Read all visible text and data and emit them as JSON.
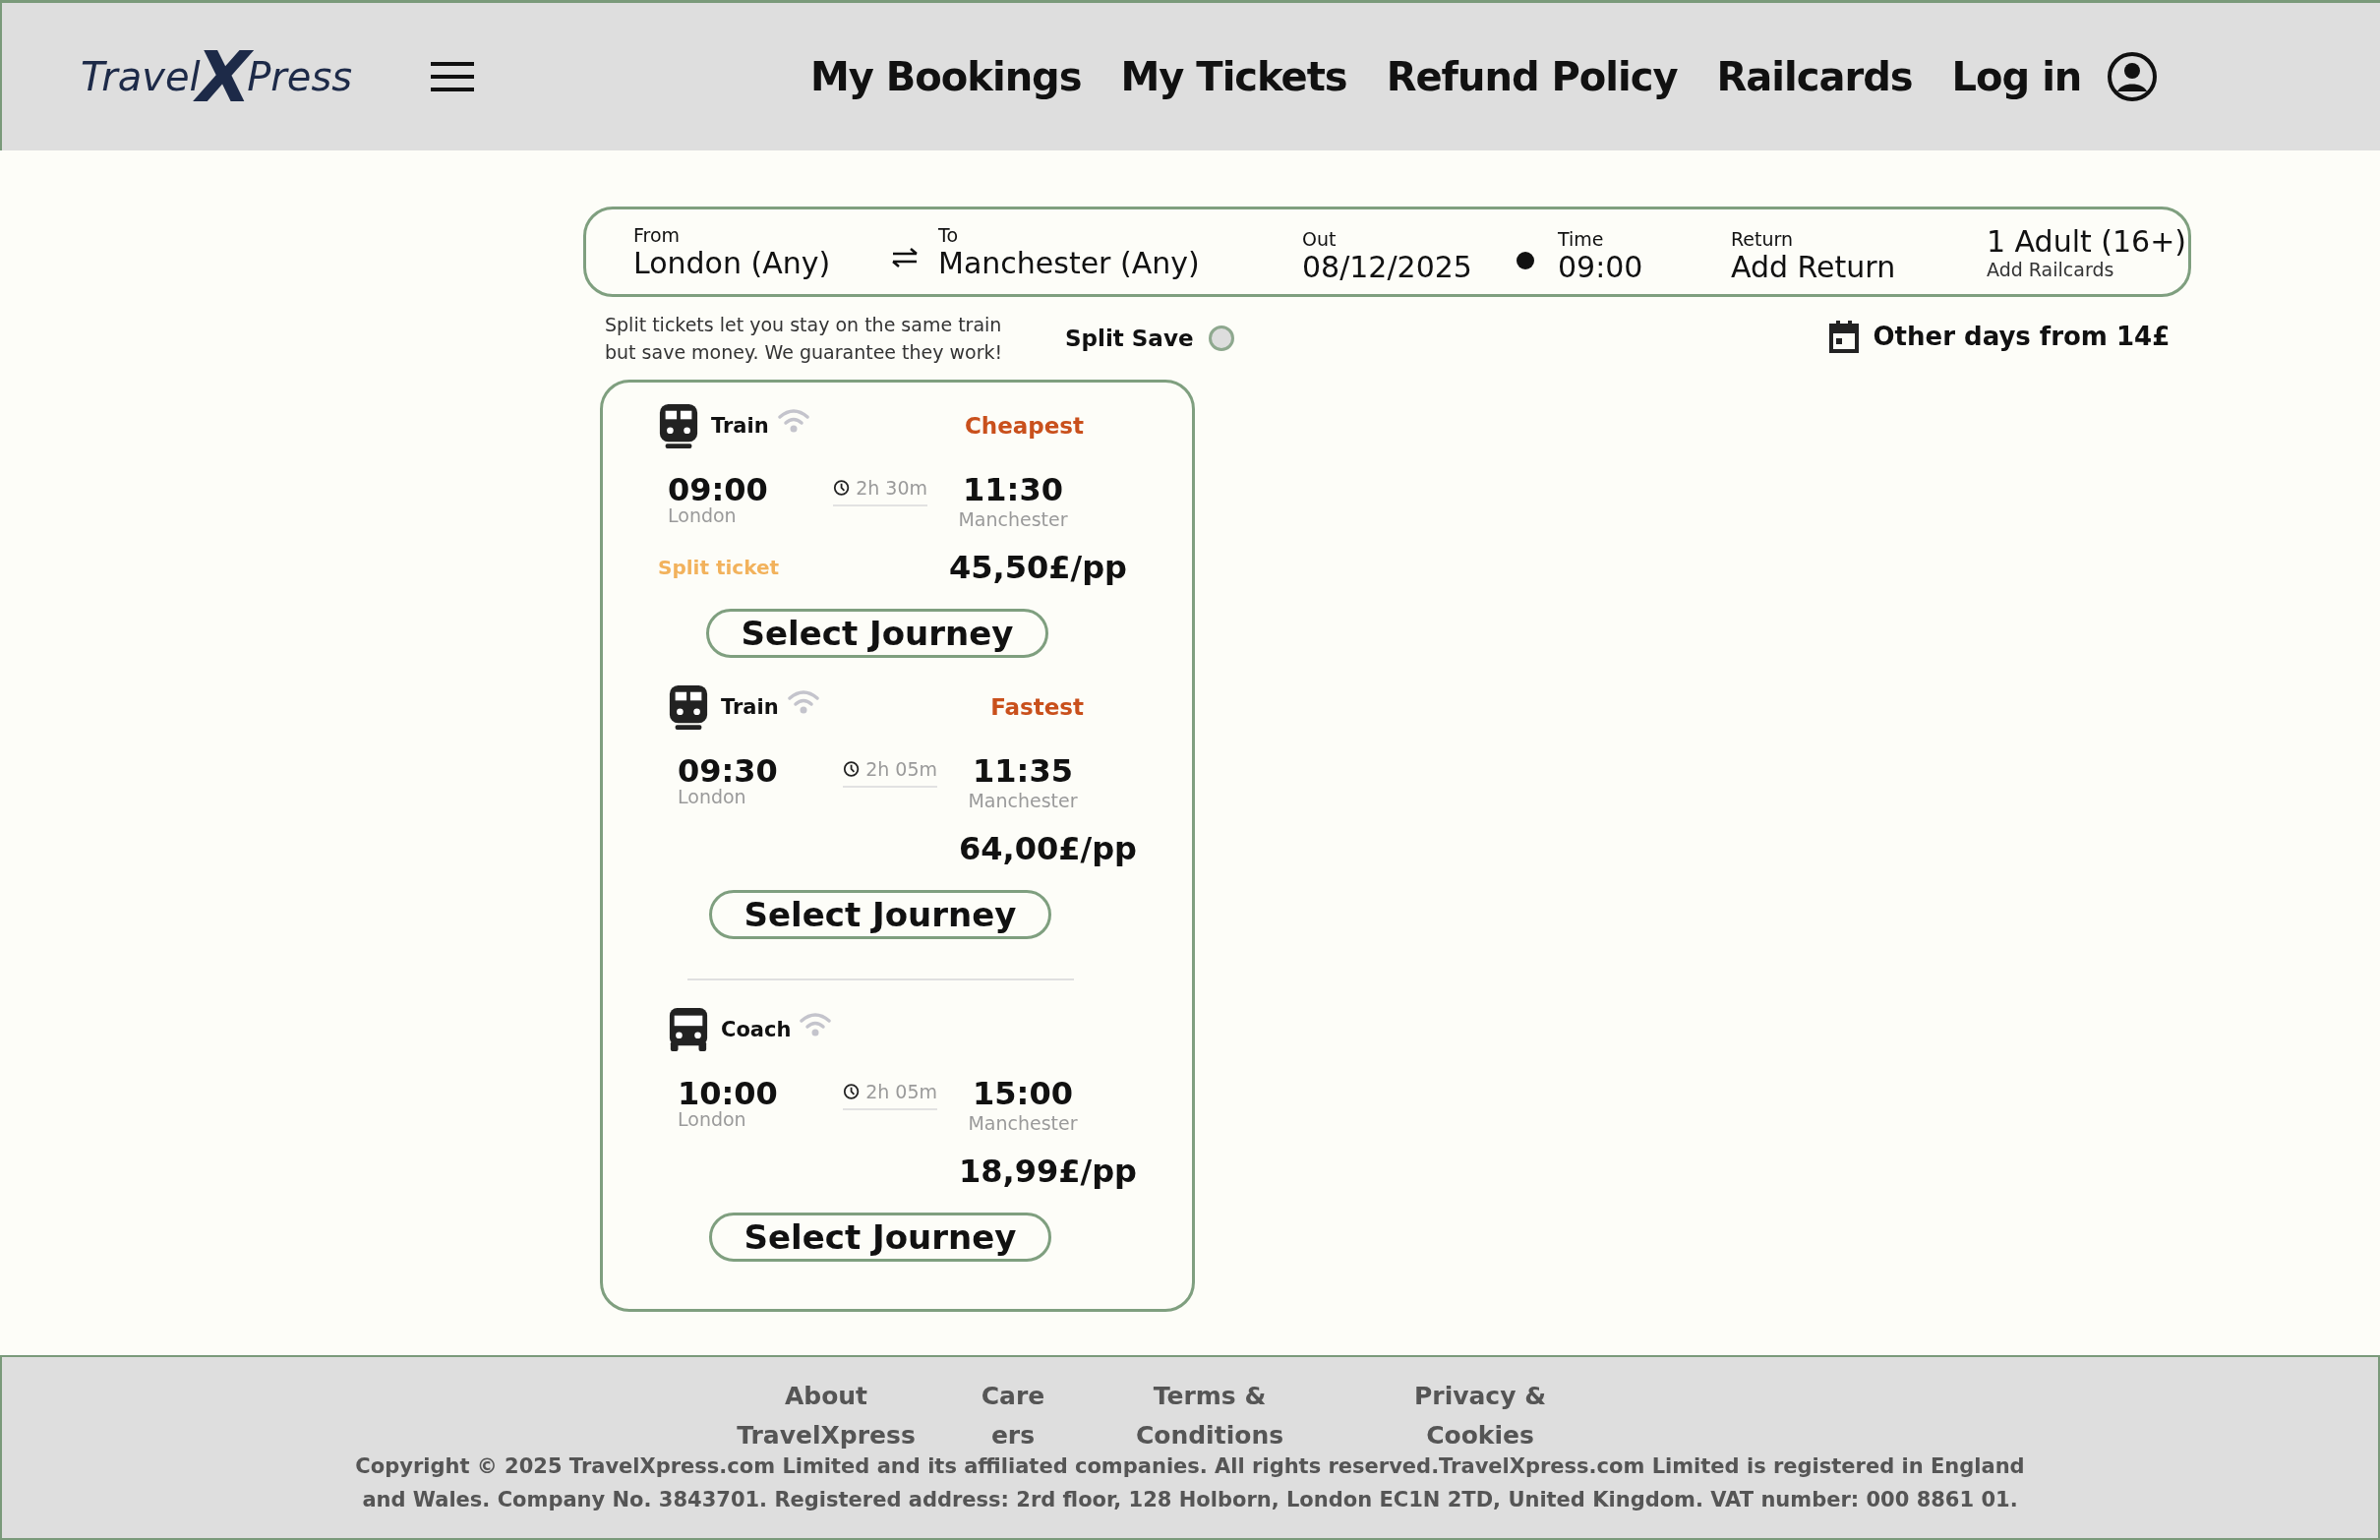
{
  "header": {
    "logo": {
      "before": "Travel",
      "mark": "X",
      "after": "Press"
    },
    "nav": [
      "My Bookings",
      "My Tickets",
      "Refund Policy",
      "Railcards"
    ],
    "login": "Log in"
  },
  "search": {
    "from": {
      "label": "From",
      "value": "London (Any)"
    },
    "to": {
      "label": "To",
      "value": "Manchester (Any)"
    },
    "out": {
      "label": "Out",
      "value": "08/12/2025"
    },
    "time": {
      "label": "Time",
      "value": "09:00"
    },
    "return": {
      "label": "Return",
      "value": "Add Return"
    },
    "passengers": {
      "value": "1 Adult (16+)",
      "link": "Add Railcards"
    }
  },
  "split_note": "Split tickets let you stay on the same train but save money. We guarantee they work!",
  "split_save": {
    "label": "Split Save",
    "on": false
  },
  "other_days": "Other days from 14£",
  "journeys": [
    {
      "kind": "train",
      "mode": "Train",
      "tag": "Cheapest",
      "depart": "09:00",
      "depart_station": "London",
      "duration": "2h 30m",
      "arrive": "11:30",
      "arrive_station": "Manchester",
      "note": "Split ticket",
      "price": "45,50£/pp",
      "button": "Select Journey"
    },
    {
      "kind": "train",
      "mode": "Train",
      "tag": "Fastest",
      "depart": "09:30",
      "depart_station": "London",
      "duration": "2h 05m",
      "arrive": "11:35",
      "arrive_station": "Manchester",
      "price": "64,00£/pp",
      "button": "Select Journey"
    },
    {
      "kind": "coach",
      "mode": "Coach",
      "depart": "10:00",
      "depart_station": "London",
      "duration": "2h 05m",
      "arrive": "15:00",
      "arrive_station": "Manchester",
      "price": "18,99£/pp",
      "button": "Select Journey"
    }
  ],
  "footer": {
    "links": [
      "About TravelXpress",
      "Careers",
      "Terms & Conditions",
      "Privacy & Cookies"
    ],
    "copyright": "Copyright © 2025 TravelXpress.com Limited and its affiliated companies. All rights reserved.TravelXpress.com Limited is registered in England and Wales. Company No. 3843701. Registered address: 2rd floor, 128 Holborn, London EC1N 2TD, United Kingdom. VAT number: 000 8861 01."
  }
}
